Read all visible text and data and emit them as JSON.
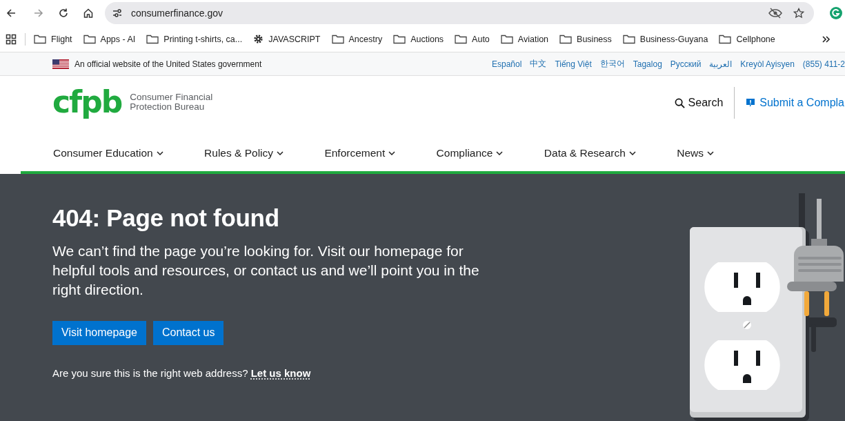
{
  "browser": {
    "url": "consumerfinance.gov",
    "bookmarks": [
      {
        "label": "Flight",
        "kind": "folder"
      },
      {
        "label": "Apps - AI",
        "kind": "folder"
      },
      {
        "label": "Printing t-shirts, ca...",
        "kind": "folder"
      },
      {
        "label": "JAVASCRIPT",
        "kind": "gear"
      },
      {
        "label": "Ancestry",
        "kind": "folder"
      },
      {
        "label": "Auctions",
        "kind": "folder"
      },
      {
        "label": "Auto",
        "kind": "folder"
      },
      {
        "label": "Aviation",
        "kind": "folder"
      },
      {
        "label": "Business",
        "kind": "folder"
      },
      {
        "label": "Business-Guyana",
        "kind": "folder"
      },
      {
        "label": "Cellphone",
        "kind": "folder"
      }
    ]
  },
  "gov_banner": {
    "text": "An official website of the United States government",
    "languages": [
      "Español",
      "中文",
      "Tiếng Việt",
      "한국어",
      "Tagalog",
      "Русский",
      "العربية",
      "Kreyòl Ayisyen",
      "(855) 411-2"
    ]
  },
  "header": {
    "logo_mark": "cfpb",
    "logo_lines": [
      "Consumer Financial",
      "Protection Bureau"
    ],
    "search": "Search",
    "complaint": "Submit a Compla"
  },
  "nav": [
    "Consumer Education",
    "Rules & Policy",
    "Enforcement",
    "Compliance",
    "Data & Research",
    "News"
  ],
  "hero": {
    "title": "404: Page not found",
    "body": "We can’t find the page you’re looking for. Visit our homepage for helpful tools and resources, or contact us and we’ll point you in the right direction.",
    "buttons": [
      "Visit homepage",
      "Contact us"
    ],
    "note": "Are you sure this is the right web address?",
    "note_link": "Let us know"
  }
}
